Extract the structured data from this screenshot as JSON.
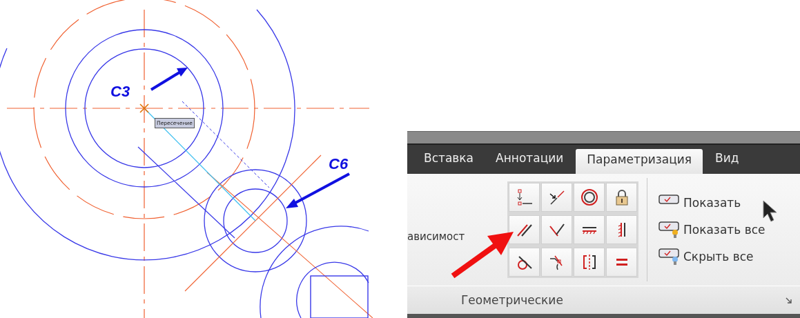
{
  "drawing": {
    "labels": [
      "C3",
      "C6"
    ],
    "tooltip": "Пересечение"
  },
  "ribbon": {
    "tabs": [
      {
        "label": "Вставка",
        "selected": false
      },
      {
        "label": "Аннотации",
        "selected": false
      },
      {
        "label": "Параметризация",
        "selected": true
      },
      {
        "label": "Вид",
        "selected": false
      }
    ],
    "cut_label": "ависимост",
    "display_buttons": [
      "Показать",
      "Показать все",
      "Скрыть все"
    ],
    "panel_title": "Геометрические"
  }
}
